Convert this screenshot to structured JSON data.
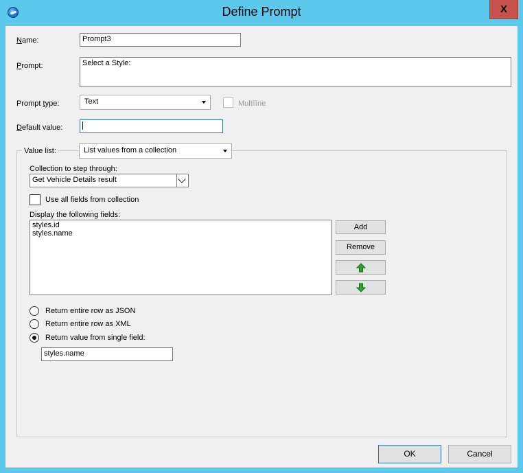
{
  "window": {
    "title": "Define Prompt",
    "close_label": "X"
  },
  "form": {
    "name_label_first": "N",
    "name_label_rest": "ame:",
    "name_value": "Prompt3",
    "prompt_label_first": "P",
    "prompt_label_rest": "rompt:",
    "prompt_value": "Select a Style:",
    "prompt_type_label_pre": "Prompt ",
    "prompt_type_label_u": "t",
    "prompt_type_label_post": "ype:",
    "prompt_type_value": "Text",
    "multiline_label": "Multiline",
    "default_value_label_first": "D",
    "default_value_label_rest": "efault value:",
    "default_value": ""
  },
  "value_list": {
    "label": "Value list:",
    "mode": "List values from a collection",
    "collection_label": "Collection to step through:",
    "collection_value": "Get Vehicle Details result",
    "use_all_fields_label": "Use all fields from collection",
    "display_fields_label": "Display the following fields:",
    "fields": [
      "styles.id",
      "styles.name"
    ],
    "add_label": "Add",
    "remove_label": "Remove",
    "return_options": [
      {
        "label": "Return entire row as JSON",
        "checked": false
      },
      {
        "label": "Return entire row as XML",
        "checked": false
      },
      {
        "label": "Return value from single field:",
        "checked": true
      }
    ],
    "single_field_value": "styles.name"
  },
  "buttons": {
    "ok": "OK",
    "cancel": "Cancel"
  },
  "colors": {
    "titlebar": "#5bc8ec",
    "close": "#c7514b",
    "dialog_bg": "#f0f0f0",
    "arrow_green": "#2fa52f"
  }
}
